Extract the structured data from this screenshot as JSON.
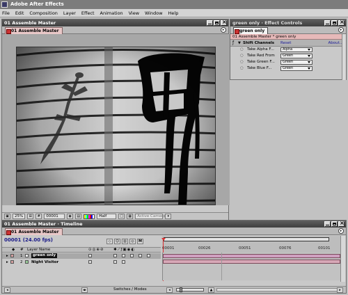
{
  "app": {
    "title": "Adobe After Effects"
  },
  "menu": [
    "File",
    "Edit",
    "Composition",
    "Layer",
    "Effect",
    "Animation",
    "View",
    "Window",
    "Help"
  ],
  "comp_window": {
    "title": "01 Assemble Master",
    "tab": "01 Assemble Master",
    "footer": {
      "zoom": "25%",
      "timecode": "00001",
      "resolution": "Half",
      "camera": "Active Camera"
    }
  },
  "effect_controls": {
    "title": "green only · Effect Controls",
    "tab": "green only",
    "path": "01 Assemble Master * green only",
    "effect_name": "Shift Channels",
    "reset": "Reset",
    "about": "About...",
    "rows": [
      {
        "label": "Take Alpha F...",
        "value": "Alpha"
      },
      {
        "label": "Take Red From",
        "value": "Green"
      },
      {
        "label": "Take Green F...",
        "value": "Green"
      },
      {
        "label": "Take Blue F...",
        "value": "Green"
      }
    ]
  },
  "timeline": {
    "title": "01 Assemble Master · Timeline",
    "tab": "01 Assemble Master",
    "timecode": "00001 (24.00 fps)",
    "col_num": "#",
    "col_layer": "Layer Name",
    "ruler": [
      "00001",
      "00026",
      "00051",
      "00076",
      "00101"
    ],
    "layers": [
      {
        "num": "1",
        "name": "green only"
      },
      {
        "num": "2",
        "name": "Night Visitor"
      }
    ],
    "footer": "Switches / Modes"
  },
  "colors": {
    "label_tab": "#e9c8c8",
    "track": "#d7a8b7",
    "cti": "#d33"
  }
}
